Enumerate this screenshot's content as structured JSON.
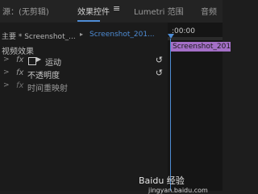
{
  "tabs": [
    {
      "label": "源：(无剪辑)"
    },
    {
      "label": "效果控件"
    },
    {
      "label": "≡"
    },
    {
      "label": "Lumetri 范围"
    },
    {
      "label": "音频"
    }
  ],
  "header": {
    "master_label": "主要 * Screenshot_...",
    "sequence_label": "Screenshot_201...",
    "caret": "▸"
  },
  "timeline": {
    "timecode": ":00:00",
    "clip_label": "Screenshot_201..."
  },
  "effects": {
    "section_title": "视频效果",
    "items": [
      {
        "label": "运动",
        "fx": "fx",
        "reset": "↺",
        "enabled": true
      },
      {
        "label": "不透明度",
        "fx": "fx",
        "reset": "↺",
        "enabled": true
      },
      {
        "label": "时间重映射",
        "fx": "fx",
        "reset": "",
        "enabled": false
      }
    ]
  },
  "watermark": {
    "text": "Baidu 经验",
    "sub": "jingyan.baidu.com"
  },
  "colors": {
    "accent": "#4e8cd4",
    "clip": "#a46fc7"
  }
}
